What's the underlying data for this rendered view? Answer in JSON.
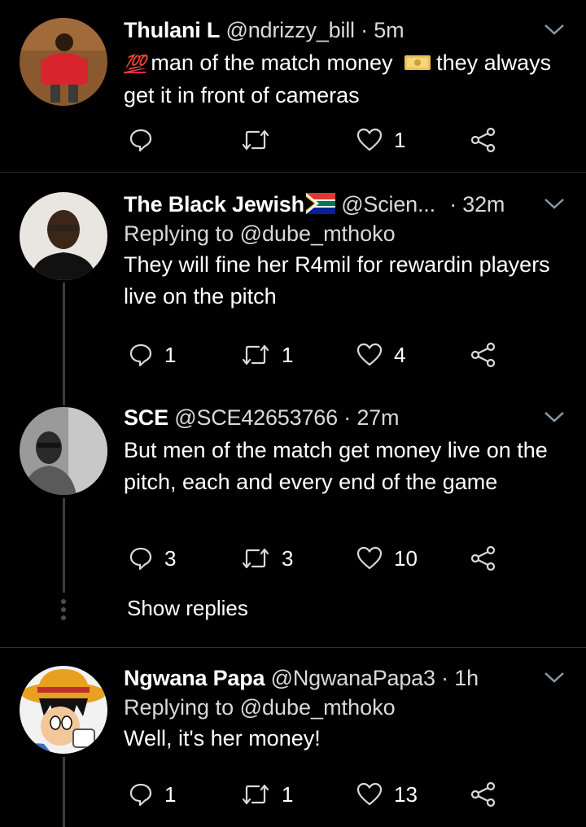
{
  "tweets": [
    {
      "name": "Thulani L",
      "handle": "@ndrizzy_bill",
      "dot": "·",
      "time": "5m",
      "replying": "",
      "body_emoji": "💯",
      "body_text_1": "man of the match money",
      "body_text_2": "they always get it in front of cameras",
      "money_icon": "money-emoji-icon",
      "reply_count": "",
      "retweet_count": "",
      "like_count": "1"
    },
    {
      "name": "The Black Jewish",
      "handle": "@Scien...",
      "dot": "·",
      "time": "32m",
      "flag_icon": "south-africa-flag-icon",
      "replying": "Replying to @dube_mthoko",
      "body": "They will fine her R4mil for rewardin players live on the pitch",
      "reply_count": "1",
      "retweet_count": "1",
      "like_count": "4"
    },
    {
      "name": "SCE",
      "handle": "@SCE42653766",
      "dot": "·",
      "time": "27m",
      "replying": "",
      "body": "But men of the match get money live on the pitch, each and every end of the game",
      "reply_count": "3",
      "retweet_count": "3",
      "like_count": "10"
    },
    {
      "name": "Ngwana Papa",
      "handle": "@NgwanaPapa3",
      "dot": "·",
      "time": "1h",
      "replying": "Replying to @dube_mthoko",
      "body": "Well, it's her money!",
      "reply_count": "1",
      "retweet_count": "1",
      "like_count": "13"
    }
  ],
  "show_replies": "Show replies",
  "colors": {
    "background": "#000000",
    "text": "#ffffff",
    "secondary": "#d9d9d9",
    "divider": "#2f3336",
    "icon": "#d9d9d9"
  }
}
